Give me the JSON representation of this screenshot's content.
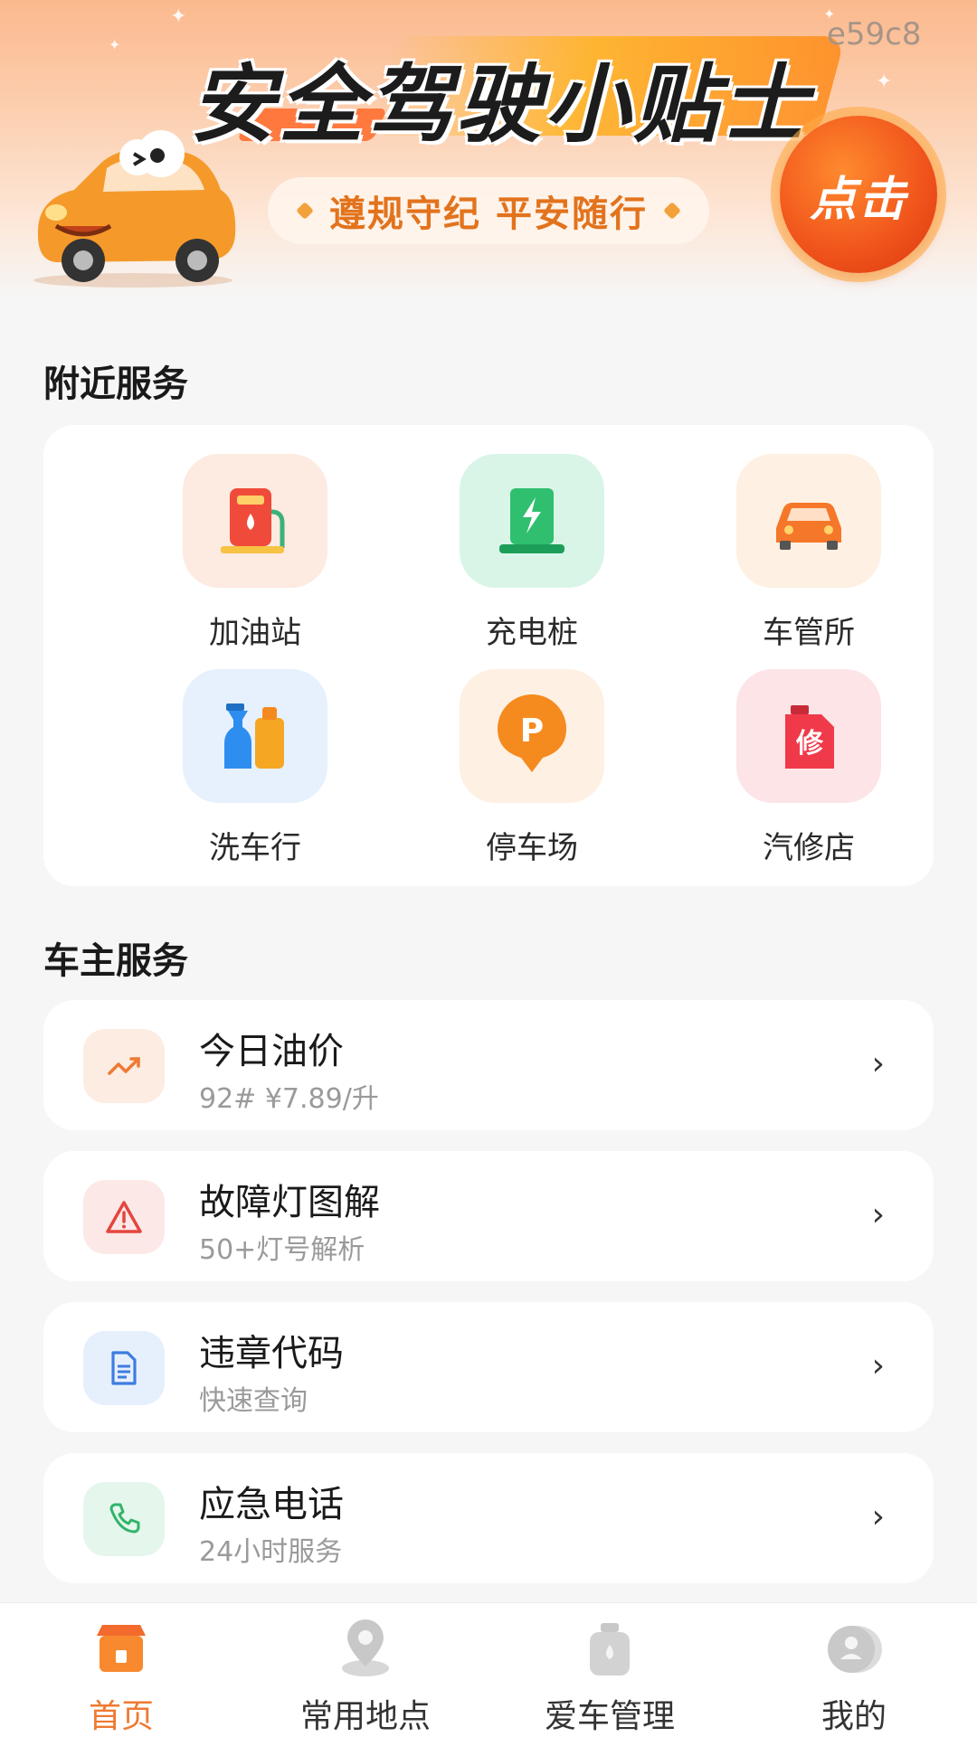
{
  "banner": {
    "title": "安全驾驶小贴士",
    "slogan": "遵规守纪  平安随行",
    "click_label": "点击",
    "code": "e59c8"
  },
  "nearby": {
    "title": "附近服务",
    "items": [
      {
        "label": "加油站",
        "icon": "gas-pump-icon"
      },
      {
        "label": "充电桩",
        "icon": "charging-pile-icon"
      },
      {
        "label": "车管所",
        "icon": "car-icon"
      },
      {
        "label": "洗车行",
        "icon": "car-wash-bottles-icon"
      },
      {
        "label": "停车场",
        "icon": "parking-pin-icon"
      },
      {
        "label": "汽修店",
        "icon": "repair-can-icon"
      }
    ]
  },
  "owner": {
    "title": "车主服务",
    "items": [
      {
        "title": "今日油价",
        "subtitle": "92# ¥7.89/升",
        "icon": "trend-up-icon"
      },
      {
        "title": "故障灯图解",
        "subtitle": "50+灯号解析",
        "icon": "warning-triangle-icon"
      },
      {
        "title": "违章代码",
        "subtitle": "快速查询",
        "icon": "document-icon"
      },
      {
        "title": "应急电话",
        "subtitle": "24小时服务",
        "icon": "phone-icon"
      }
    ]
  },
  "nav": {
    "tabs": [
      {
        "label": "首页",
        "icon": "home-shop-icon",
        "active": true
      },
      {
        "label": "常用地点",
        "icon": "location-pin-icon",
        "active": false
      },
      {
        "label": "爱车管理",
        "icon": "oil-can-icon",
        "active": false
      },
      {
        "label": "我的",
        "icon": "user-avatar-icon",
        "active": false
      }
    ]
  },
  "colors": {
    "accent": "#ee7a33",
    "background": "#f6f6f6",
    "card": "#ffffff"
  }
}
